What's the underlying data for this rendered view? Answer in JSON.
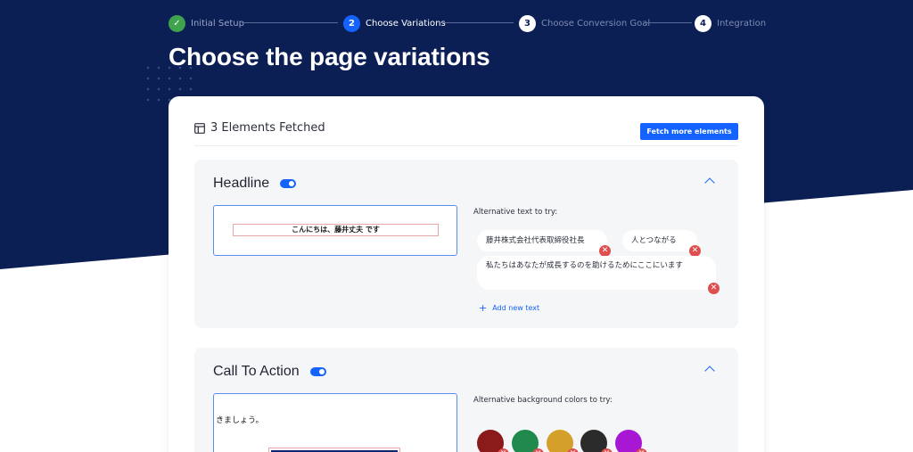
{
  "stepper": {
    "steps": [
      {
        "number": "✓",
        "label": "Initial Setup",
        "state": "done"
      },
      {
        "number": "2",
        "label": "Choose Variations",
        "state": "active"
      },
      {
        "number": "3",
        "label": "Choose Conversion Goal",
        "state": "todo"
      },
      {
        "number": "4",
        "label": "Integration",
        "state": "todo"
      }
    ]
  },
  "page": {
    "title": "Choose the page variations"
  },
  "card": {
    "fetched_label": "3 Elements Fetched",
    "fetch_button": "Fetch more elements"
  },
  "headline": {
    "title": "Headline",
    "preview_text": "こんにちは、藤井丈夫 です",
    "alt_label": "Alternative text to try:",
    "chips": [
      "藤井株式会社代表取締役社長",
      "人とつながる",
      "私たちはあなたが成長するのを助けるためにここにいます"
    ],
    "add_text": "Add new text"
  },
  "cta": {
    "title": "Call To Action",
    "preview_text": "きましょう。",
    "alt_label": "Alternative background colors to try:",
    "colors": [
      "#8b1a1a",
      "#1f8a4c",
      "#d4a02a",
      "#2b2b2b",
      "#a818d4"
    ]
  },
  "colors": {
    "navy": "#0b1f55",
    "accent": "#1463ff",
    "done": "#3fa34d",
    "remove": "#e04f4f"
  }
}
